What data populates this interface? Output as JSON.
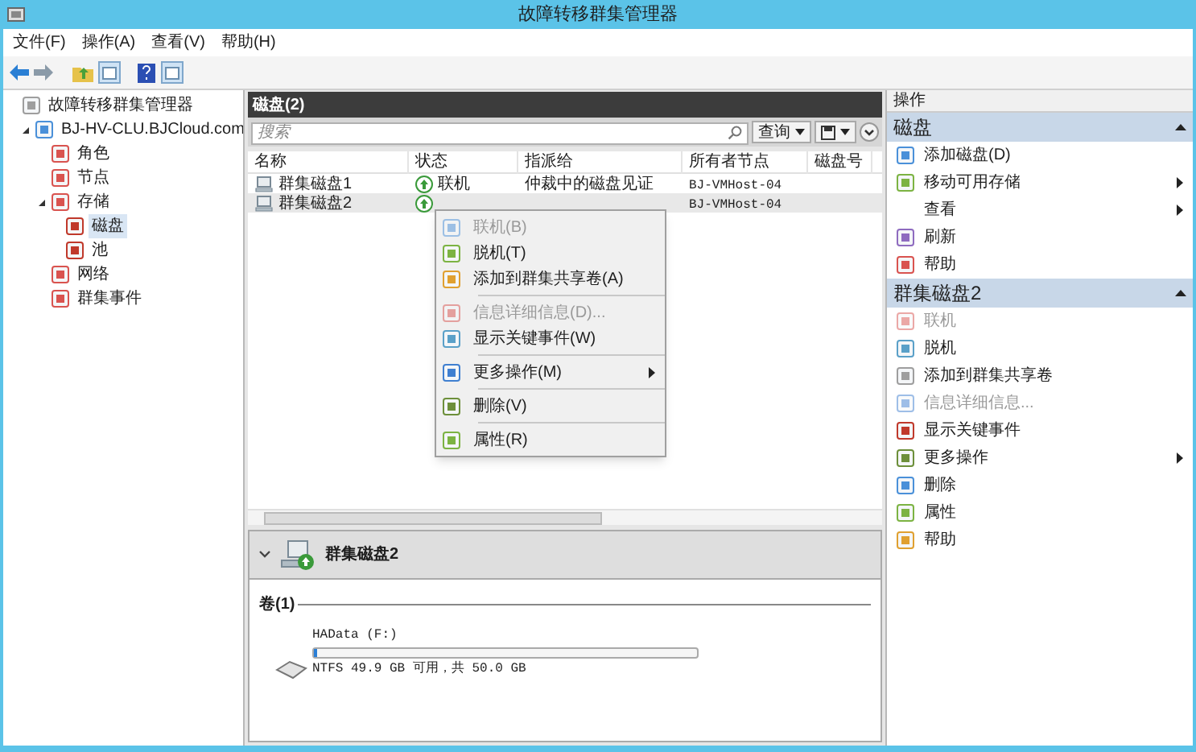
{
  "window": {
    "title": "故障转移群集管理器"
  },
  "menu": [
    "文件(F)",
    "操作(A)",
    "查看(V)",
    "帮助(H)"
  ],
  "tree": [
    {
      "label": "故障转移群集管理器",
      "selected": false,
      "children": [
        {
          "label": "BJ-HV-CLU.BJCloud.com",
          "selected": false,
          "expanded": true,
          "children": [
            {
              "label": "角色",
              "selected": false
            },
            {
              "label": "节点",
              "selected": false
            },
            {
              "label": "存储",
              "selected": false,
              "expanded": true,
              "children": [
                {
                  "label": "磁盘",
                  "selected": true
                },
                {
                  "label": "池",
                  "selected": false
                }
              ]
            },
            {
              "label": "网络",
              "selected": false
            },
            {
              "label": "群集事件",
              "selected": false
            }
          ]
        }
      ]
    }
  ],
  "center": {
    "title": "磁盘(2)",
    "search": {
      "placeholder": "搜索"
    },
    "query_button": "查询",
    "table": {
      "columns": [
        "名称",
        "状态",
        "指派给",
        "所有者节点",
        "磁盘号"
      ],
      "rows": [
        {
          "name": "群集磁盘1",
          "status": "联机",
          "assigned": "仲裁中的磁盘见证",
          "owner": "BJ-VMHost-04",
          "selected": false
        },
        {
          "name": "群集磁盘2",
          "owner": "BJ-VMHost-04",
          "selected": true
        }
      ]
    },
    "context_menu": [
      {
        "kind": "item",
        "label": "联机(B)",
        "disabled": true,
        "submenu": false
      },
      {
        "kind": "item",
        "label": "脱机(T)",
        "disabled": false,
        "submenu": false
      },
      {
        "kind": "item",
        "label": "添加到群集共享卷(A)",
        "disabled": false,
        "submenu": false
      },
      {
        "kind": "separator"
      },
      {
        "kind": "item",
        "label": "信息详细信息(D)...",
        "disabled": true,
        "submenu": false
      },
      {
        "kind": "item",
        "label": "显示关键事件(W)",
        "disabled": false,
        "submenu": false
      },
      {
        "kind": "separator"
      },
      {
        "kind": "item",
        "label": "更多操作(M)",
        "disabled": false,
        "submenu": true
      },
      {
        "kind": "separator"
      },
      {
        "kind": "item",
        "label": "删除(V)",
        "disabled": false,
        "submenu": false
      },
      {
        "kind": "separator"
      },
      {
        "kind": "item",
        "label": "属性(R)",
        "disabled": false,
        "submenu": false
      }
    ],
    "details": {
      "title": "群集磁盘2",
      "expanded": true,
      "volumes_heading": "卷(1)",
      "volume": {
        "name": "HAData (F:)",
        "level": 0.01,
        "info": "NTFS 49.9 GB 可用，共 50.0 GB"
      }
    }
  },
  "actions": {
    "title": "操作",
    "sections": [
      {
        "title": "磁盘",
        "expanded": true,
        "items": [
          {
            "label": "添加磁盘(D)",
            "disabled": false,
            "submenu": false
          },
          {
            "label": "移动可用存储",
            "disabled": false,
            "submenu": true
          },
          {
            "label": "查看",
            "disabled": false,
            "submenu": true
          },
          {
            "label": "刷新",
            "disabled": false,
            "submenu": false
          },
          {
            "label": "帮助",
            "disabled": false,
            "submenu": false
          }
        ]
      },
      {
        "title": "群集磁盘2",
        "expanded": true,
        "items": [
          {
            "label": "联机",
            "disabled": true,
            "submenu": false
          },
          {
            "label": "脱机",
            "disabled": false,
            "submenu": false
          },
          {
            "label": "添加到群集共享卷",
            "disabled": false,
            "submenu": false
          },
          {
            "label": "信息详细信息...",
            "disabled": true,
            "submenu": false
          },
          {
            "label": "显示关键事件",
            "disabled": false,
            "submenu": false
          },
          {
            "label": "更多操作",
            "disabled": false,
            "submenu": true
          },
          {
            "label": "删除",
            "disabled": false,
            "submenu": false
          },
          {
            "label": "属性",
            "disabled": false,
            "submenu": false
          },
          {
            "label": "帮助",
            "disabled": false,
            "submenu": false
          }
        ]
      }
    ]
  }
}
